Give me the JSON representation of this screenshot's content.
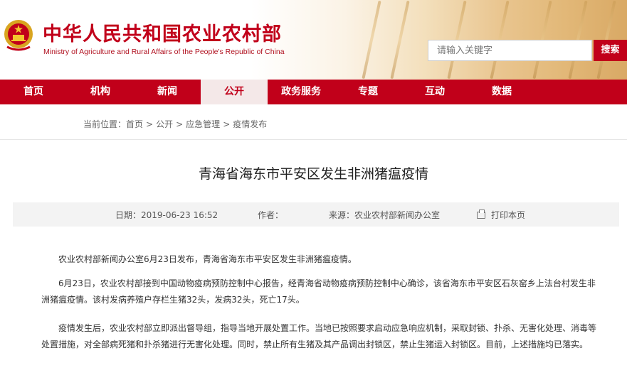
{
  "header": {
    "site_title": "中华人民共和国农业农村部",
    "site_subtitle": "Ministry of Agriculture and Rural Affairs of the People's Republic of China",
    "search_placeholder": "请输入关键字",
    "search_button": "搜索"
  },
  "nav": {
    "items": [
      {
        "label": "首页"
      },
      {
        "label": "机构"
      },
      {
        "label": "新闻"
      },
      {
        "label": "公开",
        "active": true
      },
      {
        "label": "政务服务"
      },
      {
        "label": "专题"
      },
      {
        "label": "互动"
      },
      {
        "label": "数据"
      }
    ]
  },
  "breadcrumb": {
    "prefix": "当前位置：",
    "items": [
      "首页",
      "公开",
      "应急管理",
      "疫情发布"
    ],
    "separator": ">"
  },
  "article": {
    "title": "青海省海东市平安区发生非洲猪瘟疫情",
    "meta": {
      "date": "日期：2019-06-23 16:52",
      "author": "作者：",
      "source": "来源：农业农村部新闻办公室",
      "print": "打印本页"
    },
    "paragraphs": [
      "农业农村部新闻办公室6月23日发布，青海省海东市平安区发生非洲猪瘟疫情。",
      "6月23日，农业农村部接到中国动物疫病预防控制中心报告，经青海省动物疫病预防控制中心确诊，该省海东市平安区石灰窑乡上法台村发生非洲猪瘟疫情。该村发病养殖户存栏生猪32头，发病32头，死亡17头。",
      "疫情发生后，农业农村部立即派出督导组，指导当地开展处置工作。当地已按照要求启动应急响应机制，采取封锁、扑杀、无害化处理、消毒等处置措施，对全部病死猪和扑杀猪进行无害化处理。同时，禁止所有生猪及其产品调出封锁区，禁止生猪运入封锁区。目前，上述措施均已落实。"
    ]
  },
  "colors": {
    "brand_red": "#c1001a",
    "nav_active_bg": "#f4e8e8",
    "meta_bg": "#f3f3f3"
  }
}
